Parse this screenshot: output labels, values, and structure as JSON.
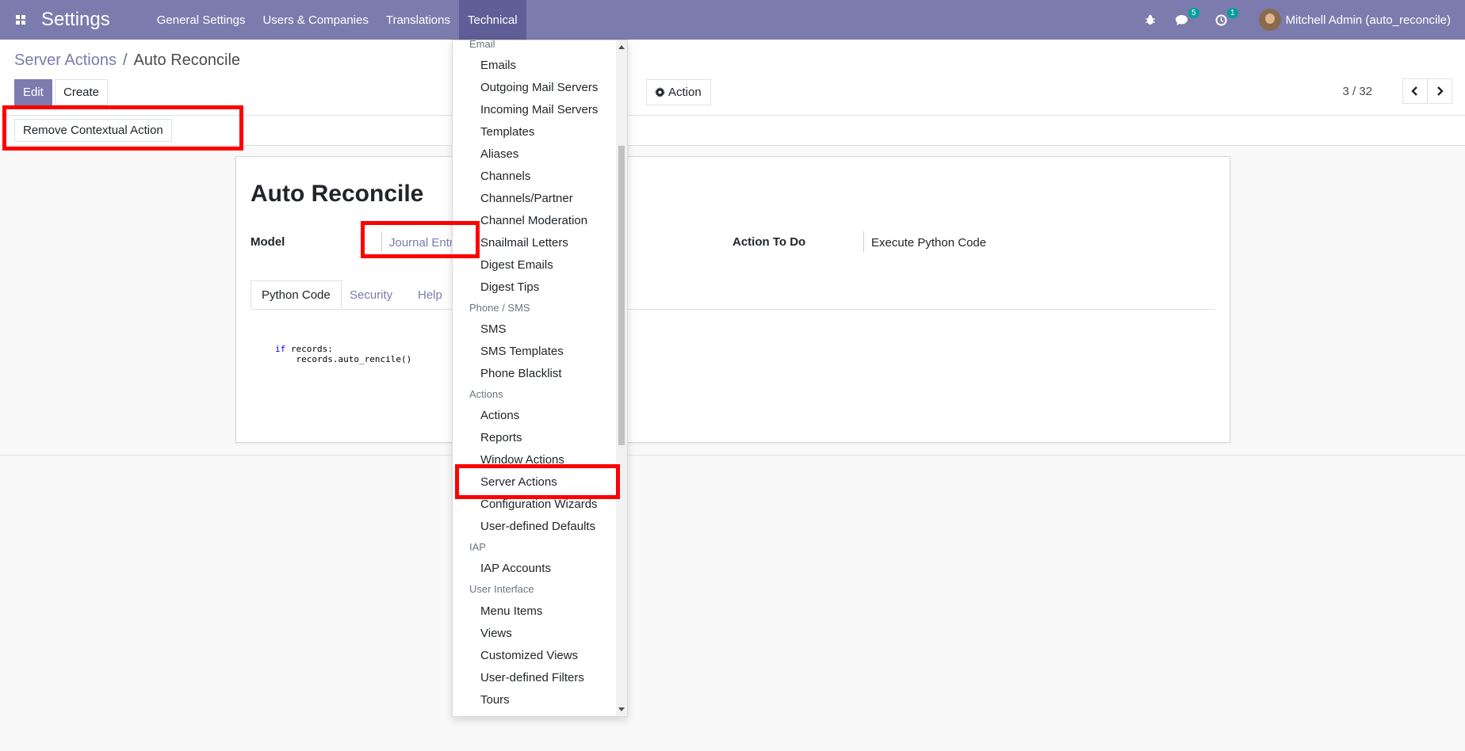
{
  "navbar": {
    "brand": "Settings",
    "menus": [
      "General Settings",
      "Users & Companies",
      "Translations",
      "Technical"
    ],
    "messages_count": "5",
    "activities_count": "1",
    "user_name": "Mitchell Admin (auto_reconcile)",
    "color": "#7c7bad"
  },
  "breadcrumb": {
    "parent": "Server Actions",
    "separator": "/",
    "current": "Auto Reconcile"
  },
  "buttons": {
    "edit": "Edit",
    "create": "Create",
    "action": "Action",
    "remove_contextual": "Remove Contextual Action"
  },
  "pager": {
    "value": "3 / 32"
  },
  "form": {
    "title": "Auto Reconcile",
    "model_label": "Model",
    "model_value": "Journal Entry",
    "action_label": "Action To Do",
    "action_value": "Execute Python Code",
    "tabs": [
      "Python Code",
      "Security",
      "Help"
    ],
    "code_keyword": "if",
    "code_line1": " records:",
    "code_line2": "    records.auto_rencile()"
  },
  "dropdown": {
    "email_header": "Email",
    "email_items": [
      "Emails",
      "Outgoing Mail Servers",
      "Incoming Mail Servers",
      "Templates",
      "Aliases",
      "Channels",
      "Channels/Partner",
      "Channel Moderation",
      "Snailmail Letters",
      "Digest Emails",
      "Digest Tips"
    ],
    "phone_header": "Phone / SMS",
    "phone_items": [
      "SMS",
      "SMS Templates",
      "Phone Blacklist"
    ],
    "actions_header": "Actions",
    "actions_items": [
      "Actions",
      "Reports",
      "Window Actions",
      "Server Actions",
      "Configuration Wizards",
      "User-defined Defaults"
    ],
    "iap_header": "IAP",
    "iap_items": [
      "IAP Accounts"
    ],
    "ui_header": "User Interface",
    "ui_items": [
      "Menu Items",
      "Views",
      "Customized Views",
      "User-defined Filters",
      "Tours"
    ]
  },
  "highlight_color": "#ff0000"
}
